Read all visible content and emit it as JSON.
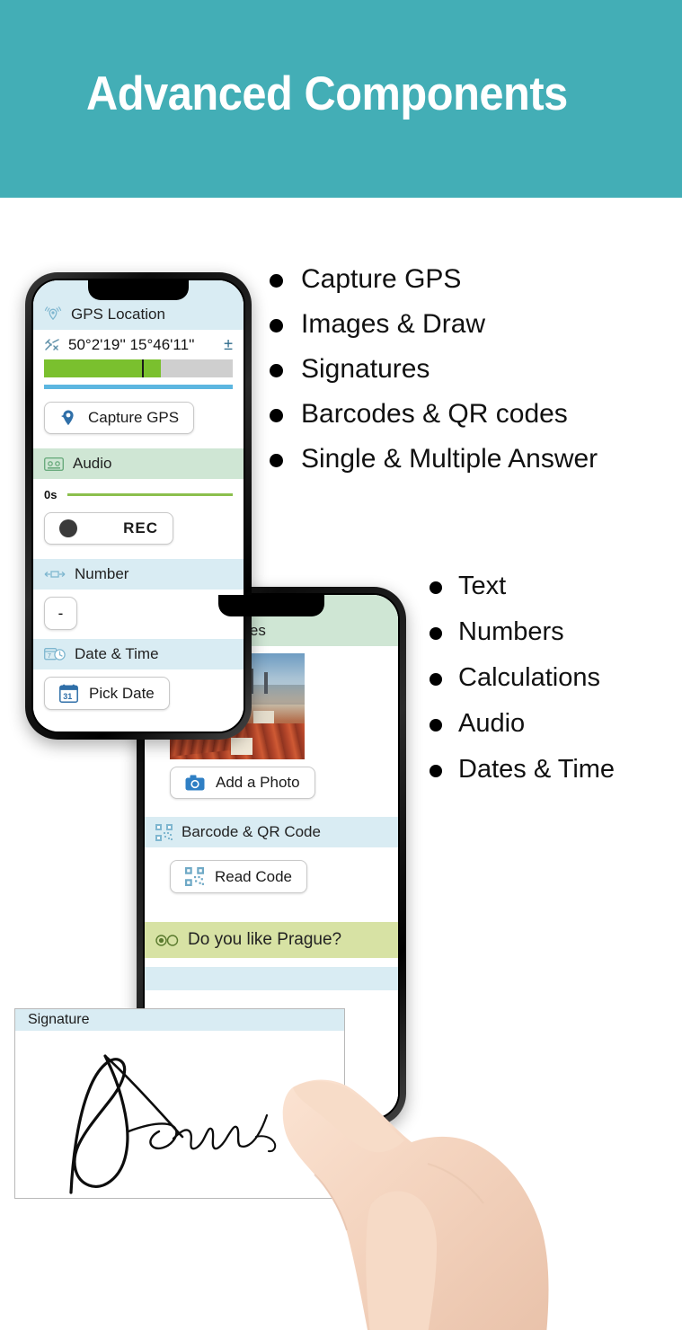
{
  "header": {
    "title": "Advanced Components",
    "background_color": "#43aeb6",
    "text_color": "#ffffff"
  },
  "bullets_primary": [
    {
      "label": "Capture GPS"
    },
    {
      "label": "Images & Draw"
    },
    {
      "label": "Signatures"
    },
    {
      "label": "Barcodes & QR codes"
    },
    {
      "label": "Single & Multiple Answer"
    }
  ],
  "bullets_secondary": [
    {
      "label": "Text"
    },
    {
      "label": "Numbers"
    },
    {
      "label": "Calculations"
    },
    {
      "label": "Audio"
    },
    {
      "label": "Dates & Time"
    }
  ],
  "phone_gps": {
    "sections": {
      "gps": {
        "header_label": "GPS Location",
        "header_icon": "gps-signal-icon",
        "header_color": "#d9ecf3",
        "coordinates": "50°2'19'' 15°46'11''",
        "coordinate_icon": "satellite-icon",
        "accuracy_symbol": "±",
        "progress_percent": 62,
        "progress_tick_percent": 52,
        "progress_color": "#7ac02e",
        "button_label": "Capture GPS",
        "button_icon": "gps-pin-icon"
      },
      "audio": {
        "header_label": "Audio",
        "header_icon": "cassette-tape-icon",
        "header_color": "#cfe6d4",
        "duration": "0s",
        "button_label": "REC",
        "button_icon": "record-dot-icon"
      },
      "number": {
        "header_label": "Number",
        "header_icon": "width-arrows-icon",
        "header_color": "#d9ecf3",
        "field_value": "-"
      },
      "datetime": {
        "header_label": "Date & Time",
        "header_icon": "calendar-clock-icon",
        "header_color": "#d9ecf3",
        "button_label": "Pick Date",
        "button_icon": "calendar-31-icon",
        "calendar_day": "31"
      }
    }
  },
  "phone_media": {
    "sections": {
      "documents": {
        "header_label": "ments & Images",
        "header_color": "#cfe6d4",
        "photo_alt": "Prague rooftops cityscape",
        "button_label": "Add a Photo",
        "button_icon": "camera-icon"
      },
      "barcode": {
        "header_label": "Barcode & QR Code",
        "header_icon": "qr-code-icon",
        "header_color": "#d9ecf3",
        "button_label": "Read Code",
        "button_icon": "qr-code-icon"
      },
      "question": {
        "header_label": "Do you like Prague?",
        "header_icon": "radio-buttons-icon",
        "header_color": "#d7e2a4"
      }
    }
  },
  "signature_panel": {
    "header_label": "Signature",
    "header_color": "#d9ecf3",
    "signature_alt": "handwritten signature"
  }
}
